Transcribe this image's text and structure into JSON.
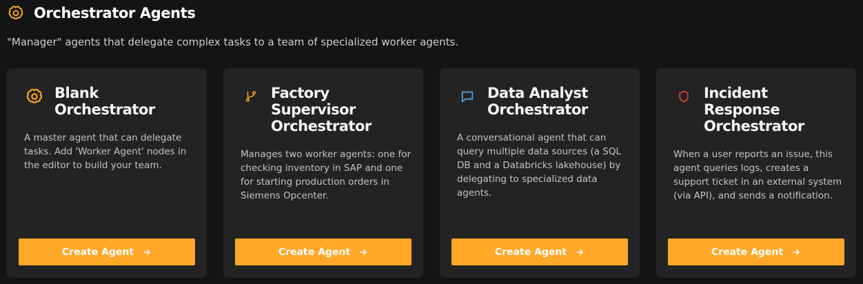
{
  "header": {
    "title": "Orchestrator Agents",
    "subtitle": "\"Manager\" agents that delegate complex tasks to a team of specialized worker agents."
  },
  "colors": {
    "accent": "#ffa726",
    "background": "#141414",
    "card": "#232323",
    "icon_blue": "#4fa3e0",
    "icon_red": "#e0443a"
  },
  "cards": [
    {
      "title": "Blank Orchestrator",
      "icon": "brain-icon",
      "description": "A master agent that can delegate tasks. Add 'Worker Agent' nodes in the editor to build your team.",
      "button_label": "Create Agent"
    },
    {
      "title": "Factory Supervisor Orchestrator",
      "icon": "git-branch-icon",
      "description": "Manages two worker agents: one for checking inventory in SAP and one for starting production orders in Siemens Opcenter.",
      "button_label": "Create Agent"
    },
    {
      "title": "Data Analyst Orchestrator",
      "icon": "chat-bubble-icon",
      "description": "A conversational agent that can query multiple data sources (a SQL DB and a Databricks lakehouse) by delegating to specialized data agents.",
      "button_label": "Create Agent"
    },
    {
      "title": "Incident Response Orchestrator",
      "icon": "shield-icon",
      "description": "When a user reports an issue, this agent queries logs, creates a support ticket in an external system (via API), and sends a notification.",
      "button_label": "Create Agent"
    }
  ]
}
